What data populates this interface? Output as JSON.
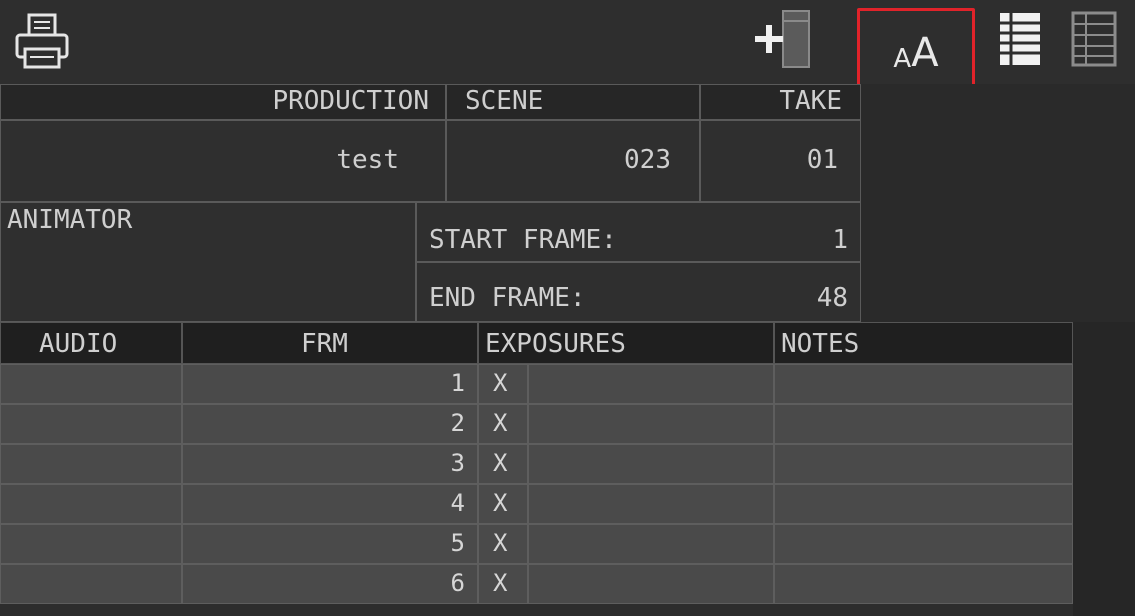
{
  "toolbar": {
    "print_icon": "printer-icon",
    "add_icon": "add-page-icon",
    "font_size_label_small": "A",
    "font_size_label_large": "A",
    "list_view_icon": "list-view-icon",
    "grid_view_icon": "grid-view-icon",
    "highlight_color": "#e1232a"
  },
  "header": {
    "production_label": "PRODUCTION",
    "scene_label": "SCENE",
    "take_label": "TAKE",
    "production_value": "test",
    "scene_value": "023",
    "take_value": "01",
    "animator_label": "ANIMATOR",
    "start_frame_label": "START FRAME:",
    "start_frame_value": "1",
    "end_frame_label": "END FRAME:",
    "end_frame_value": "48"
  },
  "grid": {
    "columns": [
      "AUDIO",
      "FRM",
      "EXPOSURES",
      "NOTES"
    ],
    "rows": [
      {
        "frm": "1",
        "exposure": "X"
      },
      {
        "frm": "2",
        "exposure": "X"
      },
      {
        "frm": "3",
        "exposure": "X"
      },
      {
        "frm": "4",
        "exposure": "X"
      },
      {
        "frm": "5",
        "exposure": "X"
      },
      {
        "frm": "6",
        "exposure": "X"
      }
    ]
  }
}
